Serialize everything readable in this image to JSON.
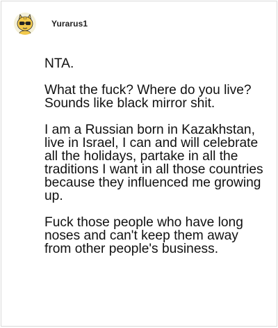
{
  "post": {
    "username": "Yurarus1",
    "avatar_icon": "cartoon-cat-avatar-icon",
    "paragraphs": [
      "NTA.",
      "What the fuck? Where do you live? Sounds like black mirror shit.",
      "I am a Russian born in Kazakhstan, live in Israel, I can and will celebrate all the holidays, partake in all the traditions I want in all those countries because they influenced me growing up.",
      "Fuck those people who have long noses and can't keep them away from other people's business."
    ]
  },
  "colors": {
    "border": "#d9d9d9",
    "text": "#111111",
    "username": "#222222"
  }
}
